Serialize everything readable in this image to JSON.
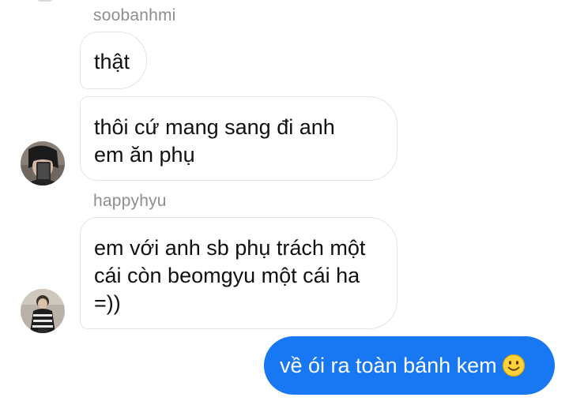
{
  "messages": [
    {
      "sender": "soobanhmi",
      "text": "thật"
    },
    {
      "sender": "soobanhmi",
      "text": "thôi cứ mang sang đi anh\nem ăn phụ"
    },
    {
      "sender": "happyhyu",
      "text": "em với anh sb phụ trách một\ncái còn beomgyu một cái ha\n=))"
    },
    {
      "sender": "me",
      "text": "về ói ra toàn bánh kem",
      "emoji": "slightly-smiling-face-icon"
    }
  ],
  "colors": {
    "outgoing_bubble": "#1877f2",
    "incoming_border": "#e3e3e3",
    "sender_name": "#8e8e8e"
  }
}
